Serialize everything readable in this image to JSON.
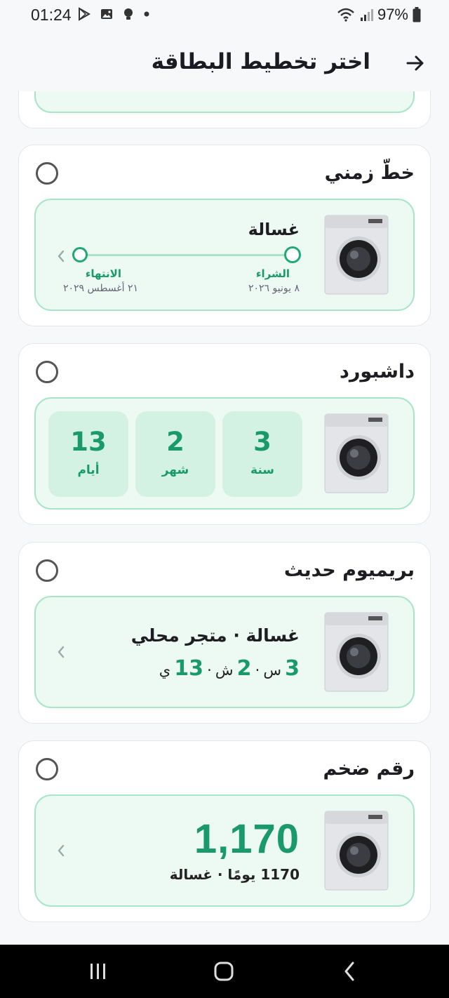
{
  "status": {
    "time": "01:24",
    "battery": "97%"
  },
  "appbar": {
    "title": "اختر تخطيط البطاقة"
  },
  "timeline_card": {
    "title": "خطّ زمني",
    "item_name": "غسالة",
    "start_label": "الشراء",
    "start_date": "٨ يونيو ٢٠٢٦",
    "end_label": "الانتهاء",
    "end_date": "٢١ أغسطس ٢٠٢٩"
  },
  "dashboard_card": {
    "title": "داشبورد",
    "tiles": [
      {
        "value": "3",
        "label": "سنة"
      },
      {
        "value": "2",
        "label": "شهر"
      },
      {
        "value": "13",
        "label": "أيام"
      }
    ]
  },
  "premium_card": {
    "title": "بريميوم حديث",
    "headline": "غسالة · متجر محلي",
    "years": "3",
    "years_unit": "س",
    "months": "2",
    "months_unit": "ش",
    "days": "13",
    "days_unit": "ي",
    "sep": "·"
  },
  "bignum_card": {
    "title": "رقم ضخم",
    "number": "1,170",
    "subtitle": "1170 يومًا · غسالة"
  },
  "colors": {
    "accent": "#1a9a6c",
    "card_bg": "#ecfaf3",
    "card_border": "#a8e5c8"
  }
}
